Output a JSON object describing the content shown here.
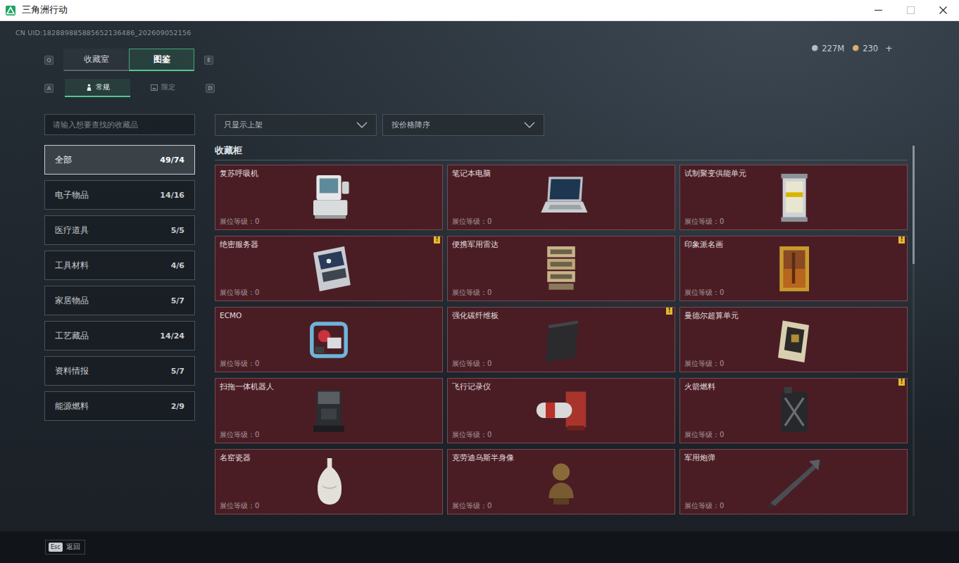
{
  "window": {
    "title": "三角洲行动",
    "controls": [
      {
        "kind": "minimize",
        "disabled": false
      },
      {
        "kind": "maximize",
        "disabled": true
      },
      {
        "kind": "close",
        "disabled": false
      }
    ]
  },
  "uid": "CN UID:182889885885652136486_202609052156",
  "currency": [
    {
      "amount": "227M",
      "color": "#b9bec4"
    },
    {
      "amount": "230",
      "color": "#d9b26a"
    }
  ],
  "currency_add": "+",
  "tabs": {
    "prev_key": "Q",
    "next_key": "E",
    "items": [
      {
        "label": "收藏室",
        "selected": false
      },
      {
        "label": "图鉴",
        "selected": true
      }
    ]
  },
  "subtabs": {
    "prev_key": "A",
    "next_key": "D",
    "items": [
      {
        "label": "常规",
        "selected": true
      },
      {
        "label": "限定",
        "selected": false
      }
    ]
  },
  "search": {
    "placeholder": "请输入想要查找的收藏品"
  },
  "sidebar": {
    "items": [
      {
        "label": "全部",
        "count": "49/74",
        "selected": true
      },
      {
        "label": "电子物品",
        "count": "14/16",
        "selected": false
      },
      {
        "label": "医疗道具",
        "count": "5/5",
        "selected": false
      },
      {
        "label": "工具材料",
        "count": "4/6",
        "selected": false
      },
      {
        "label": "家居物品",
        "count": "5/7",
        "selected": false
      },
      {
        "label": "工艺藏品",
        "count": "14/24",
        "selected": false
      },
      {
        "label": "资料情报",
        "count": "5/7",
        "selected": false
      },
      {
        "label": "能源燃料",
        "count": "2/9",
        "selected": false
      }
    ]
  },
  "filters": [
    {
      "label": "只显示上架"
    },
    {
      "label": "按价格降序"
    }
  ],
  "section_title": "收藏柜",
  "alert_mark": "!",
  "cards": [
    {
      "name": "复苏呼吸机",
      "level_label": "展位等级：0",
      "alert": false
    },
    {
      "name": "笔记本电脑",
      "level_label": "展位等级：0",
      "alert": false
    },
    {
      "name": "试制聚变供能单元",
      "level_label": "展位等级：0",
      "alert": false
    },
    {
      "name": "绝密服务器",
      "level_label": "展位等级：0",
      "alert": true
    },
    {
      "name": "便携军用雷达",
      "level_label": "展位等级：0",
      "alert": false
    },
    {
      "name": "印象派名画",
      "level_label": "展位等级：0",
      "alert": true
    },
    {
      "name": "ECMO",
      "level_label": "展位等级：0",
      "alert": false
    },
    {
      "name": "强化碳纤维板",
      "level_label": "展位等级：0",
      "alert": true
    },
    {
      "name": "曼德尔超算单元",
      "level_label": "展位等级：0",
      "alert": false
    },
    {
      "name": "扫拖一体机器人",
      "level_label": "展位等级：0",
      "alert": false
    },
    {
      "name": "飞行记录仪",
      "level_label": "展位等级：0",
      "alert": false
    },
    {
      "name": "火箭燃料",
      "level_label": "展位等级：0",
      "alert": true
    },
    {
      "name": "名窑瓷器",
      "level_label": "展位等级：0",
      "alert": false
    },
    {
      "name": "克劳迪乌斯半身像",
      "level_label": "展位等级：0",
      "alert": false
    },
    {
      "name": "军用炮弹",
      "level_label": "展位等级：0",
      "alert": false
    }
  ],
  "scrollbar": {
    "level": 0.32
  },
  "footer": {
    "key": "Esc",
    "label": "返回"
  }
}
